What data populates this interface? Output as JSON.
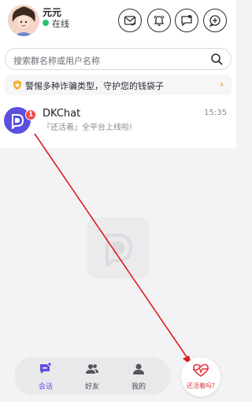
{
  "header": {
    "user_name": "元元",
    "status": "在线",
    "status_color": "#28c56a",
    "action_icons": [
      "mail-check-icon",
      "bell-icon",
      "message-square-icon",
      "add-chat-icon"
    ]
  },
  "search": {
    "placeholder": "搜索群名称或用户名称",
    "icon": "search-icon"
  },
  "tip": {
    "text": "警惕多种诈骗类型，守护您的钱袋子",
    "chevron": "›",
    "icon": "shield-star-icon"
  },
  "chats": [
    {
      "title": "DKChat",
      "preview": "『还活着』全平台上线啦!",
      "time": "15:35",
      "unread": "1"
    }
  ],
  "nav": {
    "items": [
      {
        "label": "会话",
        "icon": "chat-icon",
        "active": true
      },
      {
        "label": "好友",
        "icon": "friends-icon",
        "active": false
      },
      {
        "label": "我的",
        "icon": "profile-icon",
        "active": false
      }
    ],
    "alive_label": "还活着吗?",
    "accent": "#5b4fe0"
  }
}
